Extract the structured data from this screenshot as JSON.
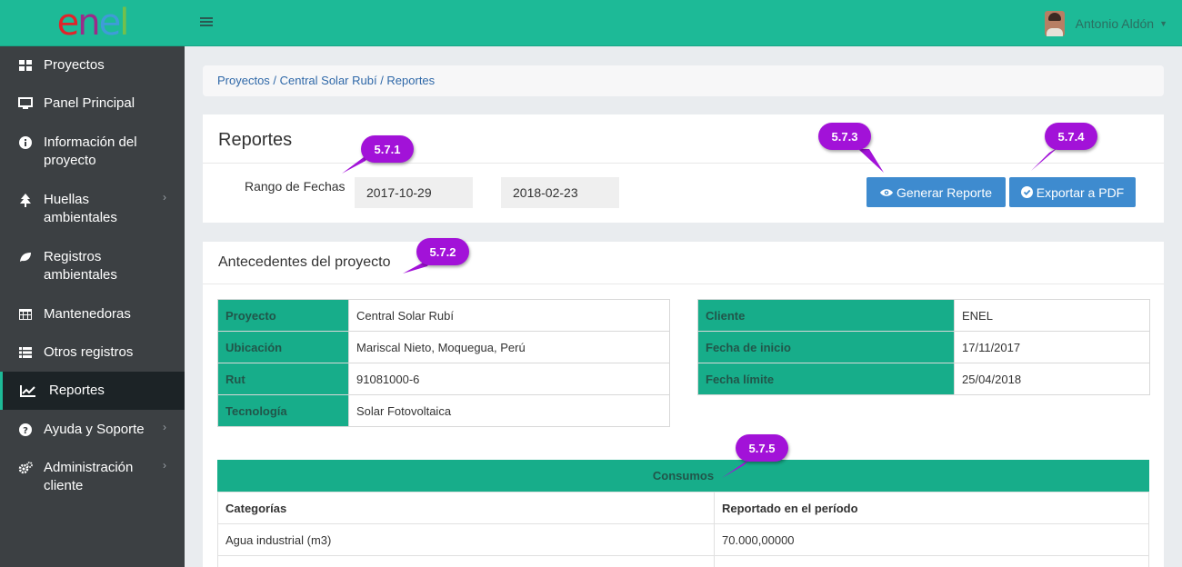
{
  "app": {
    "logo_text": "enel",
    "brand_color": "#1dba97"
  },
  "sidebar": {
    "items": [
      {
        "label": "Proyectos",
        "icon": "grid-icon"
      },
      {
        "label": "Panel Principal",
        "icon": "monitor-icon"
      },
      {
        "label": "Información del proyecto",
        "icon": "info-icon"
      },
      {
        "label": "Huellas ambientales",
        "icon": "tree-icon"
      },
      {
        "label": "Registros ambientales",
        "icon": "leaf-icon"
      },
      {
        "label": "Mantenedoras",
        "icon": "table-icon"
      },
      {
        "label": "Otros registros",
        "icon": "list-icon"
      },
      {
        "label": "Reportes",
        "icon": "line-chart-icon"
      },
      {
        "label": "Ayuda y Soporte",
        "icon": "question-icon"
      },
      {
        "label": "Administración cliente",
        "icon": "cogs-icon"
      }
    ]
  },
  "topbar": {
    "user_name": "Antonio Aldón"
  },
  "breadcrumb": "Proyectos / Central Solar Rubí / Reportes",
  "reportes": {
    "title": "Reportes",
    "range_label": "Rango de Fechas",
    "date_from": "2017-10-29",
    "date_to": "2018-02-23",
    "generate_label": "Generar Reporte",
    "export_label": "Exportar a PDF"
  },
  "antecedentes": {
    "title": "Antecedentes del proyecto",
    "left": [
      {
        "key": "Proyecto",
        "value": "Central Solar Rubí"
      },
      {
        "key": "Ubicación",
        "value": "Mariscal Nieto, Moquegua, Perú"
      },
      {
        "key": "Rut",
        "value": "91081000-6"
      },
      {
        "key": "Tecnología",
        "value": "Solar Fotovoltaica"
      }
    ],
    "right": [
      {
        "key": "Cliente",
        "value": "ENEL"
      },
      {
        "key": "Fecha de inicio",
        "value": "17/11/2017"
      },
      {
        "key": "Fecha límite",
        "value": "25/04/2018"
      }
    ]
  },
  "consumos": {
    "title": "Consumos",
    "columns": [
      "Categorías",
      "Reportado en el período"
    ],
    "rows": [
      [
        "Agua industrial (m3)",
        "70.000,00000"
      ]
    ]
  },
  "callouts": {
    "c1": "5.7.1",
    "c2": "5.7.2",
    "c3": "5.7.3",
    "c4": "5.7.4",
    "c5": "5.7.5"
  }
}
